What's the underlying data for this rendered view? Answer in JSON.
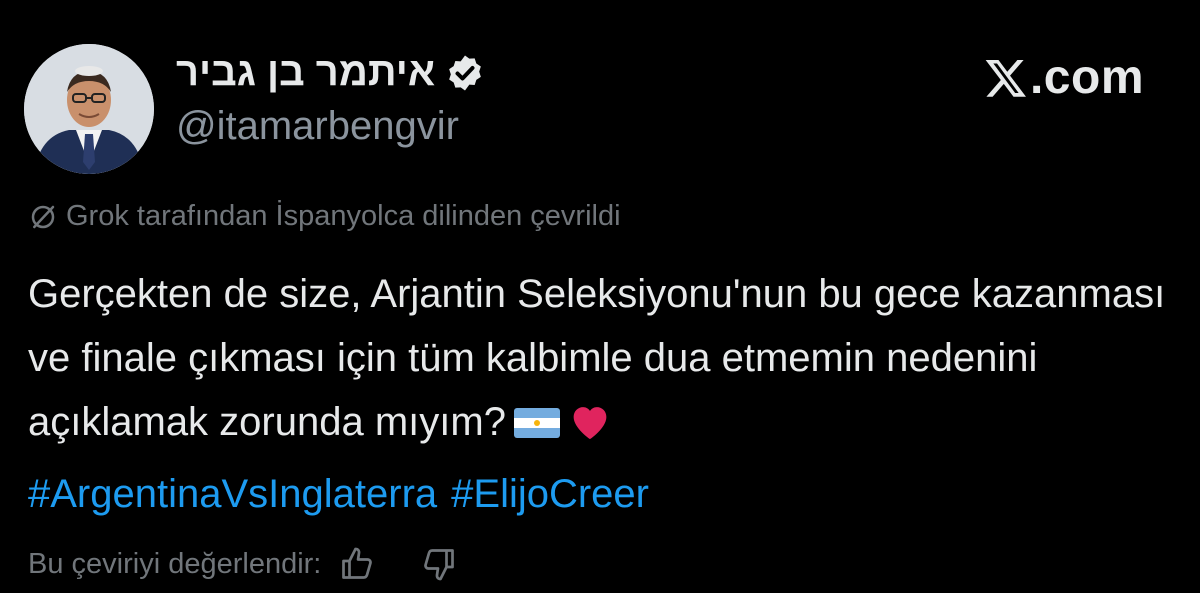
{
  "author": {
    "display_name": "איתמר בן גביר",
    "handle": "@itamarbengvir",
    "verified": true
  },
  "brand": {
    "label": ".com",
    "logo": "x-logo-icon"
  },
  "translation_note": "Grok tarafından İspanyolca dilinden çevrildi",
  "tweet": {
    "text": "Gerçekten de size, Arjantin Seleksiyonu'nun bu gece kazanması ve finale çıkması için tüm kalbimle dua etmemin nedenini açıklamak zorunda mıyım?",
    "emojis": [
      "argentina-flag-icon",
      "red-heart-icon"
    ],
    "hashtags": [
      "#ArgentinaVsInglaterra",
      "#ElijoCreer"
    ]
  },
  "rating": {
    "label": "Bu çeviriyi değerlendir:",
    "icons": [
      "thumbs-up-icon",
      "thumbs-down-icon"
    ]
  },
  "colors": {
    "background": "#000000",
    "text": "#e7e9ea",
    "muted": "#71767b",
    "link": "#1d9bf0",
    "verified": "#e7e9ea"
  }
}
